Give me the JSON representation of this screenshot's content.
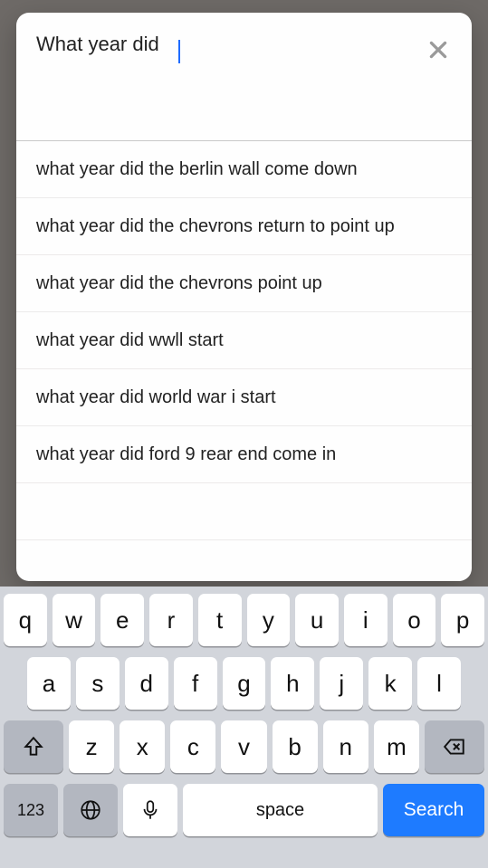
{
  "search": {
    "value": "What year did"
  },
  "suggestions": [
    "what year did the berlin wall come down",
    "what year did the chevrons return to point up",
    "what year did the chevrons point up",
    "what year did wwll start",
    "what year did world war i start",
    "what year did ford 9 rear end come in"
  ],
  "keyboard": {
    "row1": [
      "q",
      "w",
      "e",
      "r",
      "t",
      "y",
      "u",
      "i",
      "o",
      "p"
    ],
    "row2": [
      "a",
      "s",
      "d",
      "f",
      "g",
      "h",
      "j",
      "k",
      "l"
    ],
    "row3": [
      "z",
      "x",
      "c",
      "v",
      "b",
      "n",
      "m"
    ],
    "num_label": "123",
    "space_label": "space",
    "search_label": "Search"
  }
}
